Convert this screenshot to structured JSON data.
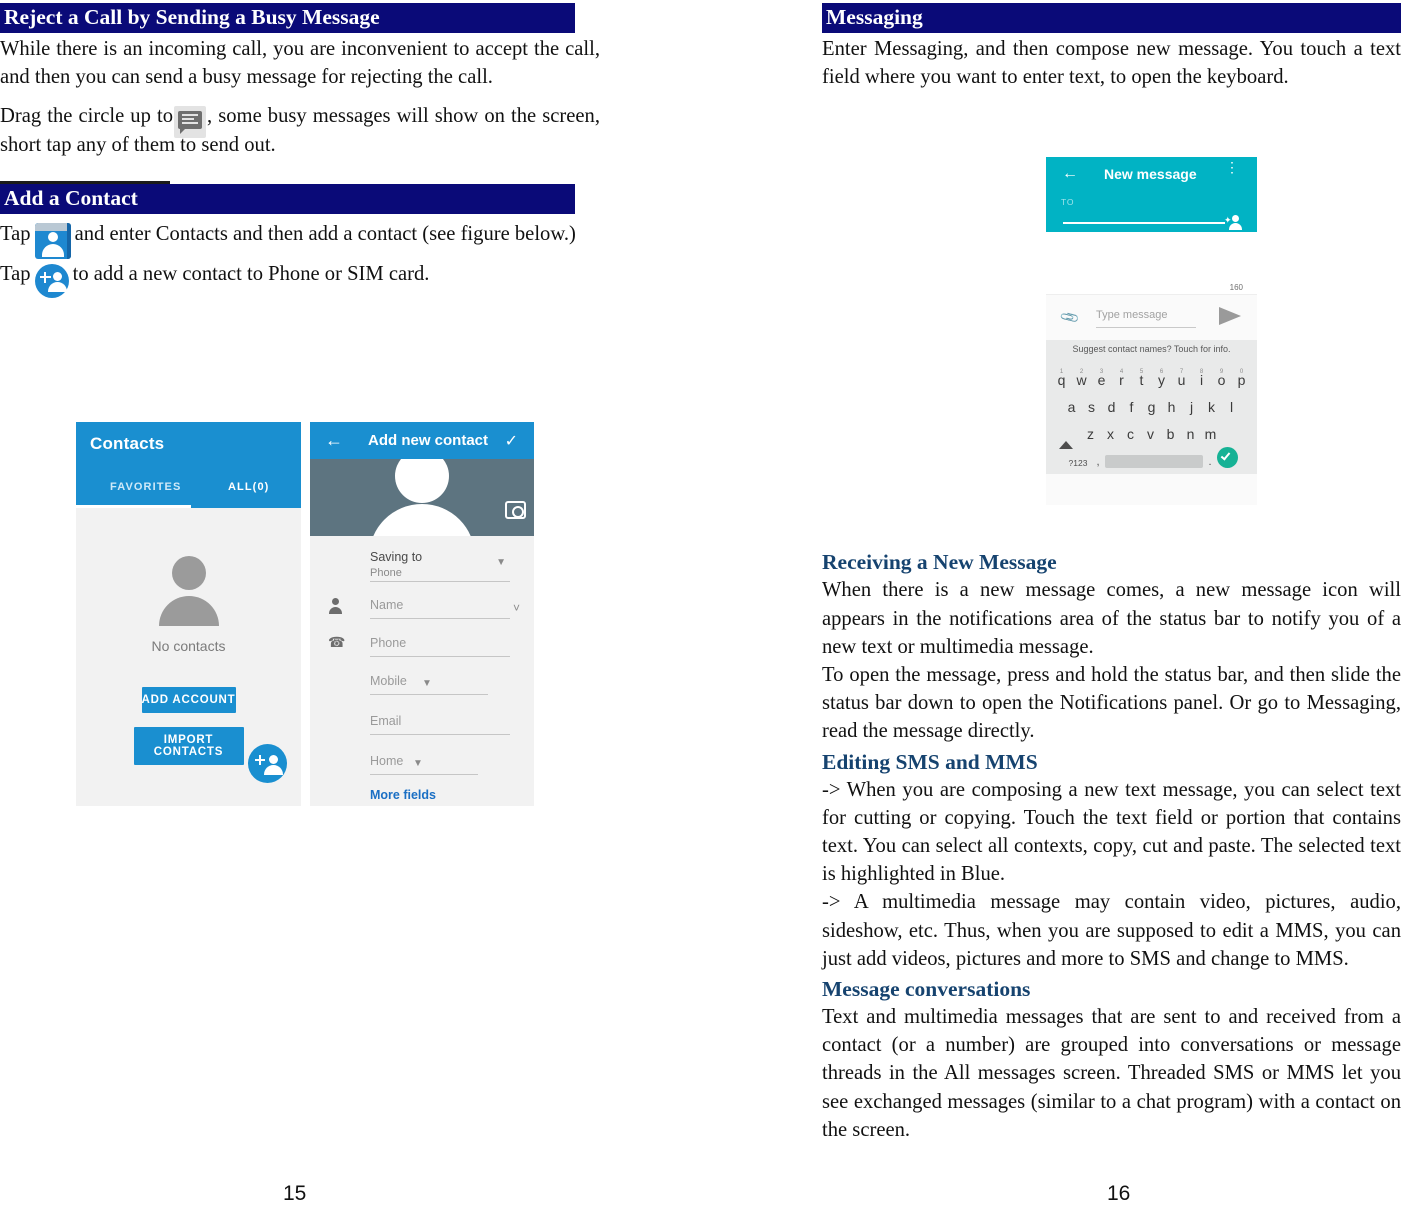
{
  "document": {
    "type": "phone-user-manual-spread",
    "left_page_number": "15",
    "right_page_number": "16"
  },
  "left_page": {
    "section_1": {
      "heading": "Reject a Call by Sending a Busy Message",
      "paragraph_1": "While there is an incoming call, you are inconvenient to accept the call, and then you can send a busy message for rejecting the call.",
      "paragraph_2_before_icon": "Drag the circle up to",
      "paragraph_2_after_icon": ", some busy messages will show on the screen, short tap any of them to send out."
    },
    "section_2": {
      "heading": "Add a Contact",
      "paragraph_1_before_icon": "Tap",
      "paragraph_1_after_icon": "and enter Contacts and then add a contact (see figure below.)",
      "paragraph_2_before_icon": "Tap",
      "paragraph_2_after_icon": "to add a new contact to Phone or SIM card."
    },
    "figure_contacts": {
      "contacts_screen": {
        "app_title": "Contacts",
        "tab_favorites": "FAVORITES",
        "tab_all": "ALL(0)",
        "empty_state": "No contacts",
        "button_add_account": "ADD ACCOUNT",
        "button_import_contacts": "IMPORT CONTACTS"
      },
      "add_contact_screen": {
        "title": "Add new contact",
        "back_icon": "←",
        "check_icon": "✓",
        "fields": [
          {
            "label": "Saving to",
            "value": "Phone",
            "icon": "account-icon",
            "has_dropdown": true
          },
          {
            "label": "Name",
            "value": "",
            "icon": "person-icon",
            "has_expand": true
          },
          {
            "label": "Phone",
            "value": "",
            "icon": "phone-icon",
            "has_dropdown": false
          },
          {
            "label": "Mobile",
            "value": "",
            "icon": "",
            "has_dropdown": true
          },
          {
            "label": "Email",
            "value": "",
            "icon": "mail-icon",
            "has_dropdown": false
          },
          {
            "label": "Home",
            "value": "",
            "icon": "",
            "has_dropdown": true
          }
        ],
        "more_fields": "More fields"
      }
    }
  },
  "right_page": {
    "section_messaging": {
      "heading": "Messaging",
      "paragraph_1": "Enter Messaging, and then compose new message. You touch a text field where you want to enter text, to open the keyboard."
    },
    "figure_new_message": {
      "title": "New message",
      "back_icon": "←",
      "overflow_icon": "⋮",
      "to_label": "TO",
      "char_count": "160",
      "compose_placeholder": "Type message",
      "suggest_banner": "Suggest contact names? Touch for info.",
      "keyboard": {
        "row1": [
          "q",
          "w",
          "e",
          "r",
          "t",
          "y",
          "u",
          "i",
          "o",
          "p"
        ],
        "row1_numbers": [
          "1",
          "2",
          "3",
          "4",
          "5",
          "6",
          "7",
          "8",
          "9",
          "0"
        ],
        "row2": [
          "a",
          "s",
          "d",
          "f",
          "g",
          "h",
          "j",
          "k",
          "l"
        ],
        "row3": [
          "z",
          "x",
          "c",
          "v",
          "b",
          "n",
          "m"
        ],
        "symbols_key": "?123",
        "comma_key": ",",
        "period_key": "."
      }
    },
    "section_receiving": {
      "heading": "Receiving a New Message",
      "paragraph_1": "When there is a new message comes, a new message icon will appears in the notifications area of the status bar to notify you of a new text or multimedia message.",
      "paragraph_2": "To open the message, press and hold the status bar, and then slide the status bar down to open the Notifications panel. Or go to Messaging, read the message directly."
    },
    "section_editing": {
      "heading": "Editing SMS and MMS",
      "paragraph_1": "-> When you are composing a new text message, you can select text for cutting or copying. Touch the text field or portion that contains text. You can select all contexts, copy, cut and paste. The selected text is highlighted in Blue.",
      "paragraph_2": "-> A multimedia message may contain video, pictures, audio, sideshow, etc. Thus, when you are supposed to edit a MMS, you can just add videos, pictures and more to SMS and change to MMS."
    },
    "section_conversations": {
      "heading": "Message conversations",
      "paragraph_1": "Text and multimedia messages that are sent to and received from a contact (or a number) are grouped into conversations or message threads in the All messages screen. Threaded SMS or MMS let you see exchanged messages (similar to a chat program) with a contact on the screen."
    }
  },
  "colors": {
    "heading_bar_bg": "#0a0a78",
    "heading_bar_text": "#ffffff",
    "subheading_text": "#16436f",
    "android_blue": "#1a8fd0",
    "messaging_teal": "#01b3c4",
    "body_text": "#111111"
  }
}
